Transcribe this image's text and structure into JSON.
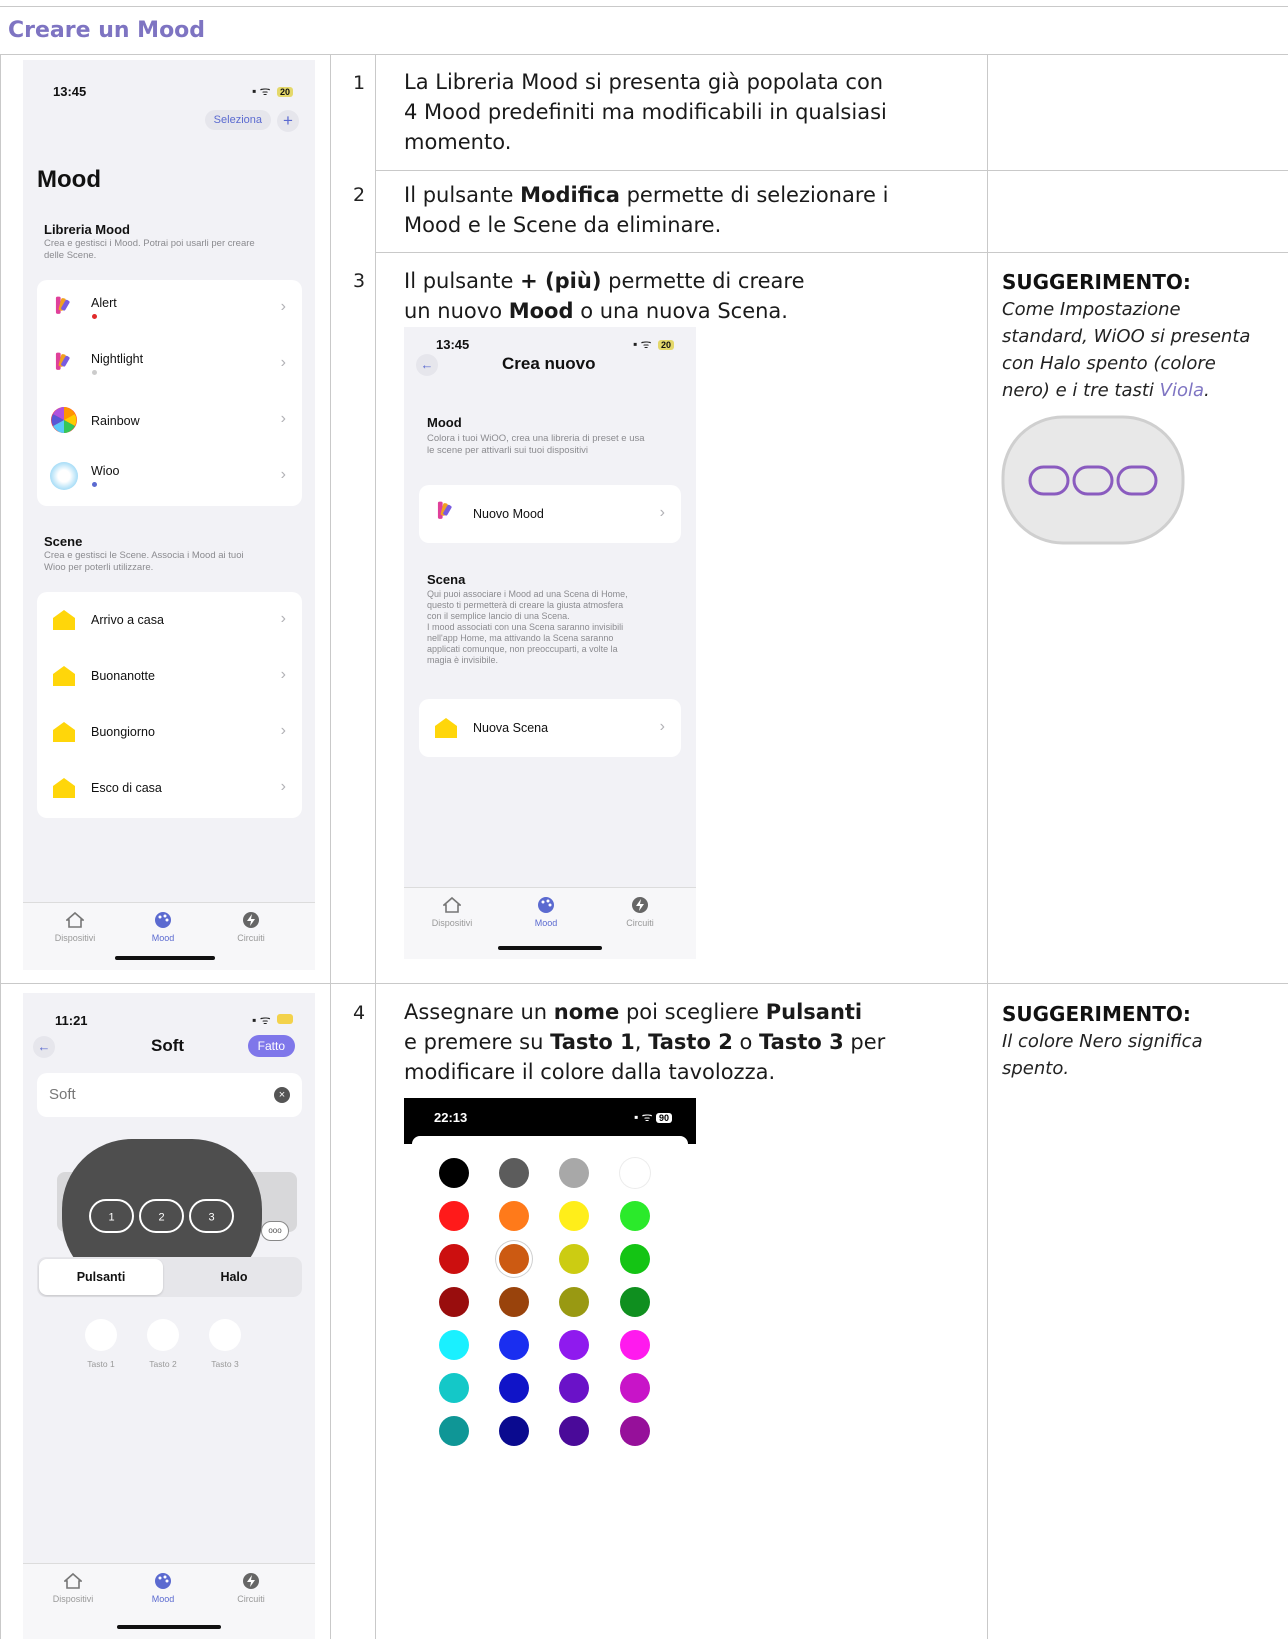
{
  "section_title": "Creare un Mood",
  "steps": [
    {
      "num": "1",
      "lines": [
        [
          {
            "t": "La Libreria Mood si presenta già popolata con"
          }
        ],
        [
          {
            "t": "4 Mood predefiniti ma modificabili in qualsiasi"
          }
        ],
        [
          {
            "t": "momento."
          }
        ]
      ]
    },
    {
      "num": "2",
      "lines": [
        [
          {
            "t": "Il pulsante "
          },
          {
            "t": "Modifica",
            "b": true
          },
          {
            "t": " permette di selezionare i"
          }
        ],
        [
          {
            "t": "Mood e le Scene da eliminare."
          }
        ]
      ]
    },
    {
      "num": "3",
      "lines": [
        [
          {
            "t": "Il pulsante "
          },
          {
            "t": "+ (più)",
            "b": true
          },
          {
            "t": " permette di creare"
          }
        ],
        [
          {
            "t": "un nuovo "
          },
          {
            "t": "Mood",
            "b": true
          },
          {
            "t": " o una nuova Scena."
          }
        ]
      ]
    },
    {
      "num": "4",
      "lines": [
        [
          {
            "t": "Assegnare un "
          },
          {
            "t": "nome",
            "b": true
          },
          {
            "t": " poi scegliere "
          },
          {
            "t": "Pulsanti",
            "b": true
          }
        ],
        [
          {
            "t": "e premere su "
          },
          {
            "t": "Tasto 1",
            "b": true
          },
          {
            "t": ", "
          },
          {
            "t": "Tasto 2",
            "b": true
          },
          {
            "t": " o "
          },
          {
            "t": "Tasto 3",
            "b": true
          },
          {
            "t": " per"
          }
        ],
        [
          {
            "t": "modificare il colore dalla tavolozza."
          }
        ]
      ]
    }
  ],
  "tips": {
    "tip1": {
      "title": "SUGGERIMENTO:",
      "line1": "Come Impostazione",
      "line2": "standard, WiOO si presenta",
      "line3": "con Halo spento (colore",
      "line4_pre": "nero) e i tre tasti ",
      "line4_link": "Viola",
      "line4_post": "."
    },
    "tip2": {
      "title": "SUGGERIMENTO:",
      "line1": "Il colore Nero significa",
      "line2": "spento."
    }
  },
  "phone_mood": {
    "time": "13:45",
    "battery": "20",
    "select_label": "Seleziona",
    "add_label": "+",
    "title": "Mood",
    "library_title": "Libreria Mood",
    "library_desc1": "Crea e gestisci i Mood. Potrai poi usarli per creare",
    "library_desc2": "delle Scene.",
    "moods": [
      {
        "label": "Alert",
        "dot": "#e02a2a"
      },
      {
        "label": "Nightlight",
        "dot": "#cccccc"
      },
      {
        "label": "Rainbow",
        "dot": ""
      },
      {
        "label": "Wioo",
        "dot": "#5b6ad0"
      }
    ],
    "scenes_title": "Scene",
    "scenes_desc1": "Crea e gestisci le Scene. Associa i Mood ai tuoi",
    "scenes_desc2": "Wioo per poterli utilizzare.",
    "scenes": [
      "Arrivo a casa",
      "Buonanotte",
      "Buongiorno",
      "Esco di casa"
    ],
    "tabs": [
      "Dispositivi",
      "Mood",
      "Circuiti"
    ]
  },
  "phone_create": {
    "time": "13:45",
    "battery": "20",
    "back": "←",
    "title": "Crea nuovo",
    "mood_title": "Mood",
    "mood_desc1": "Colora i tuoi WiOO, crea una libreria di preset e usa",
    "mood_desc2": "le scene per attivarli sui tuoi dispositivi",
    "new_mood": "Nuovo Mood",
    "scene_title": "Scena",
    "scene_desc": [
      "Qui puoi associare i Mood ad una Scena di Home,",
      "questo ti permetterà di creare la giusta atmosfera",
      "con il semplice lancio di una Scena.",
      "I mood associati con una Scena saranno invisibili",
      "nell'app Home, ma attivando la Scena saranno",
      "applicati comunque, non preoccuparti, a volte la",
      "magia è invisibile."
    ],
    "new_scene": "Nuova Scena",
    "tabs": [
      "Dispositivi",
      "Mood",
      "Circuiti"
    ]
  },
  "phone_soft": {
    "time": "11:21",
    "back": "←",
    "title": "Soft",
    "done": "Fatto",
    "name_value": "Soft",
    "keys": [
      "1",
      "2",
      "3"
    ],
    "seg": [
      "Pulsanti",
      "Halo"
    ],
    "key_labels": [
      "Tasto 1",
      "Tasto 2",
      "Tasto 3"
    ],
    "tabs": [
      "Dispositivi",
      "Mood",
      "Circuiti"
    ]
  },
  "palette": {
    "time": "22:13",
    "battery": "90",
    "colors": [
      [
        "#000000",
        "#5c5c5c",
        "#a8a8a8",
        "#ffffff"
      ],
      [
        "#ff1a1a",
        "#ff7a1a",
        "#ffee1a",
        "#2bea2b"
      ],
      [
        "#cc0f0f",
        "#cc5a12",
        "#cccc12",
        "#14c414"
      ],
      [
        "#990d0d",
        "#99430c",
        "#999912",
        "#0f8f1f"
      ],
      [
        "#1af0ff",
        "#1a2ef0",
        "#8f1aee",
        "#ff1aee"
      ],
      [
        "#14c8c8",
        "#1014c8",
        "#6a12c8",
        "#c814c8"
      ],
      [
        "#0f9696",
        "#0a0a8f",
        "#4a0a99",
        "#96109a"
      ]
    ],
    "selected": [
      2,
      1
    ]
  },
  "accent_violet": "#7e74c2"
}
